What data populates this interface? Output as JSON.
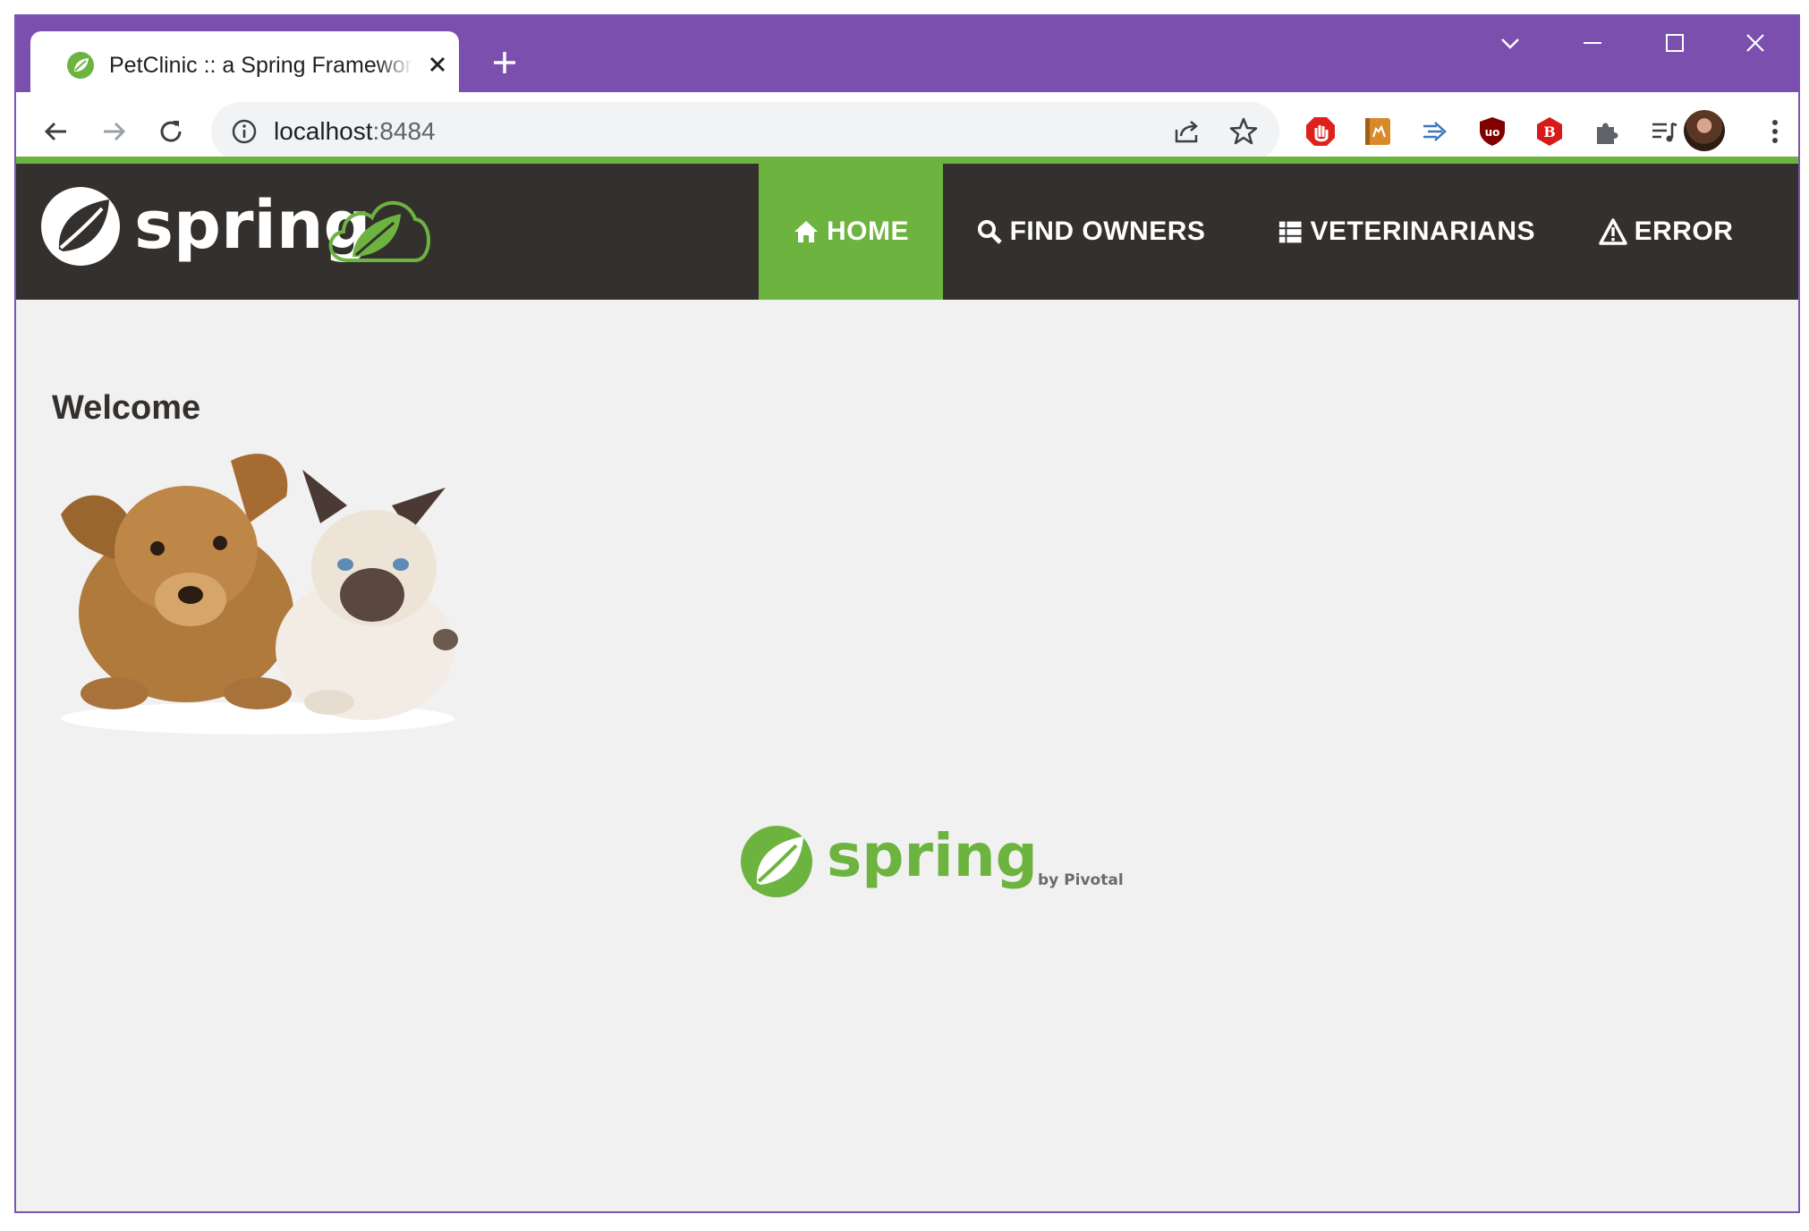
{
  "browser": {
    "tab_title": "PetClinic :: a Spring Framework demonstration",
    "url_host": "localhost",
    "url_port": ":8484"
  },
  "site": {
    "brand": "spring",
    "nav": [
      {
        "label": "HOME",
        "icon": "home-icon",
        "active": true
      },
      {
        "label": "FIND OWNERS",
        "icon": "search-icon",
        "active": false
      },
      {
        "label": "VETERINARIANS",
        "icon": "list-icon",
        "active": false
      },
      {
        "label": "ERROR",
        "icon": "warning-icon",
        "active": false
      }
    ],
    "heading": "Welcome",
    "footer_brand": "spring",
    "footer_byline": "by Pivotal."
  },
  "colors": {
    "tabstrip": "#7a4fad",
    "spring_green": "#6db33f",
    "navbar_bg": "#34302d",
    "content_bg": "#f1f1f1"
  }
}
